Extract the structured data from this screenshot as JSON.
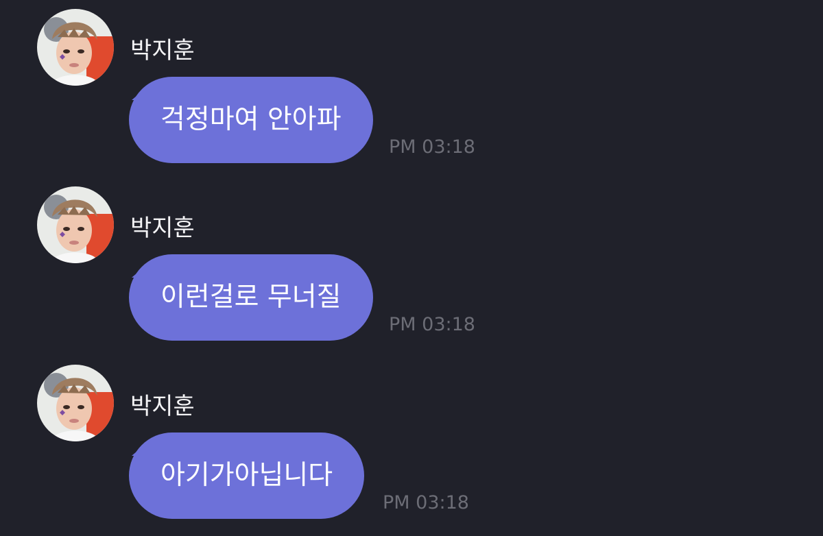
{
  "colors": {
    "background": "#20212a",
    "bubble": "#6d71d9",
    "sender_text": "#f4f4f6",
    "message_text": "#ffffff",
    "timestamp": "#6c6d76"
  },
  "messages": [
    {
      "sender": "박지훈",
      "avatar": "avatar-photo-icon",
      "text": "걱정마여 안아파",
      "time": "PM 03:18"
    },
    {
      "sender": "박지훈",
      "avatar": "avatar-photo-icon",
      "text": "이런걸로 무너질",
      "time": "PM 03:18"
    },
    {
      "sender": "박지훈",
      "avatar": "avatar-photo-icon",
      "text": "아기가아닙니다",
      "time": "PM 03:18"
    }
  ]
}
